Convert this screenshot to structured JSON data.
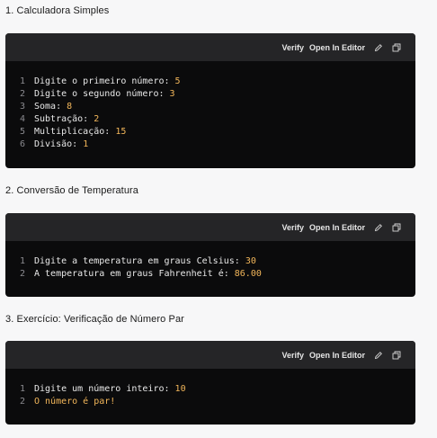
{
  "header": {
    "verify_label": "Verify",
    "open_label": "Open In Editor",
    "edit_icon": "pencil-icon",
    "copy_icon": "copy-icon"
  },
  "sections": [
    {
      "title": "1. Calculadora Simples",
      "lines": [
        {
          "num": "1",
          "text": "Digite o primeiro número: ",
          "value": "5"
        },
        {
          "num": "2",
          "text": "Digite o segundo número: ",
          "value": "3"
        },
        {
          "num": "3",
          "text": "Soma: ",
          "value": "8"
        },
        {
          "num": "4",
          "text": "Subtração: ",
          "value": "2"
        },
        {
          "num": "5",
          "text": "Multiplicação: ",
          "value": "15"
        },
        {
          "num": "6",
          "text": "Divisão: ",
          "value": "1"
        }
      ]
    },
    {
      "title": "2. Conversão de Temperatura",
      "lines": [
        {
          "num": "1",
          "text": "Digite a temperatura em graus Celsius: ",
          "value": "30"
        },
        {
          "num": "2",
          "text": "A temperatura em graus Fahrenheit é: ",
          "value": "86.00"
        }
      ]
    },
    {
      "title": "3. Exercício: Verificação de Número Par",
      "lines": [
        {
          "num": "1",
          "text": "Digite um número inteiro: ",
          "value": "10"
        },
        {
          "num": "2",
          "text": "",
          "value": "O número é par!"
        }
      ]
    }
  ],
  "colors": {
    "card_bg": "#0b0b0c",
    "header_bg": "#252527",
    "value": "#f2b65a",
    "line_number": "#8a8a8f"
  }
}
